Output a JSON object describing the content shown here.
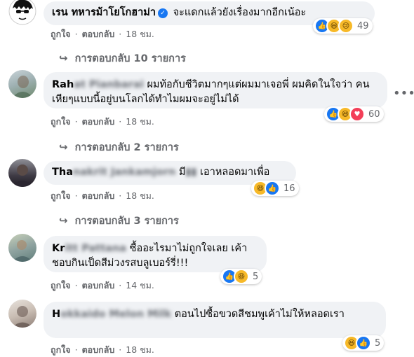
{
  "comments": [
    {
      "author": "เรน ทหารม้าโยโกฮาม่า",
      "author_hidden": "",
      "verified": true,
      "text": "จะแดกแล้วยังเรื่องมากอีกเน้อะ",
      "like_label": "ถูกใจ",
      "reply_label": "ตอบกลับ",
      "time": "18 ชม.",
      "reactions": [
        "like",
        "haha",
        "sad"
      ],
      "reaction_count": "49",
      "replies_label": "การตอบกลับ 10 รายการ"
    },
    {
      "author": "Rah",
      "author_hidden": "at Pianbarai",
      "verified": false,
      "text": "ผมท้อกับชีวิตมากๆแต่ผมมาเจอพี่ ผมคิดในใจว่า คนเหียๆแบบนี้อยู่บนโลกได้ทำไมผมจะอยู่ไม่ได้",
      "like_label": "ถูกใจ",
      "reply_label": "ตอบกลับ",
      "time": "18 ชม.",
      "reactions": [
        "like",
        "haha",
        "love"
      ],
      "reaction_count": "60",
      "replies_label": "การตอบกลับ 2 รายการ"
    },
    {
      "author": "Tha",
      "author_hidden": "nakrit Jankamjorn",
      "verified": false,
      "text_pre": "มี",
      "text": "เอาหลอดมาเพื่อ",
      "like_label": "ถูกใจ",
      "reply_label": "ตอบกลับ",
      "time": "18 ชม.",
      "reactions": [
        "haha",
        "like"
      ],
      "reaction_count": "16",
      "replies_label": "การตอบกลับ 3 รายการ"
    },
    {
      "author": "Kr",
      "author_hidden": "itt Pattana",
      "verified": false,
      "text": "ซื้ออะไรมาไม่ถูกใจเลย เค้าชอบกินเป็ดสีม่วงรสบลูเบอร์รี่!!!",
      "like_label": "ถูกใจ",
      "reply_label": "ตอบกลับ",
      "time": "14 ชม.",
      "reactions": [
        "like",
        "haha"
      ],
      "reaction_count": "5"
    },
    {
      "author": "H",
      "author_hidden": "okkaido Melon Milk",
      "verified": false,
      "text": "ตอนไปซื้อขวดสีชมพูเค้าไม่ให้หลอดเรา",
      "like_label": "ถูกใจ",
      "reply_label": "ตอบกลับ",
      "time": "18 ชม.",
      "reactions": [
        "haha",
        "like"
      ],
      "reaction_count": "5"
    }
  ],
  "colors": {
    "bubble": "#f0f2f5",
    "secondary_text": "#65676b",
    "like_blue": "#1877f2",
    "love_red": "#f33e58",
    "haha_yellow": "#f7b928"
  },
  "icons": {
    "more": "more-horizontal-icon",
    "reply": "reply-arrow-icon"
  }
}
